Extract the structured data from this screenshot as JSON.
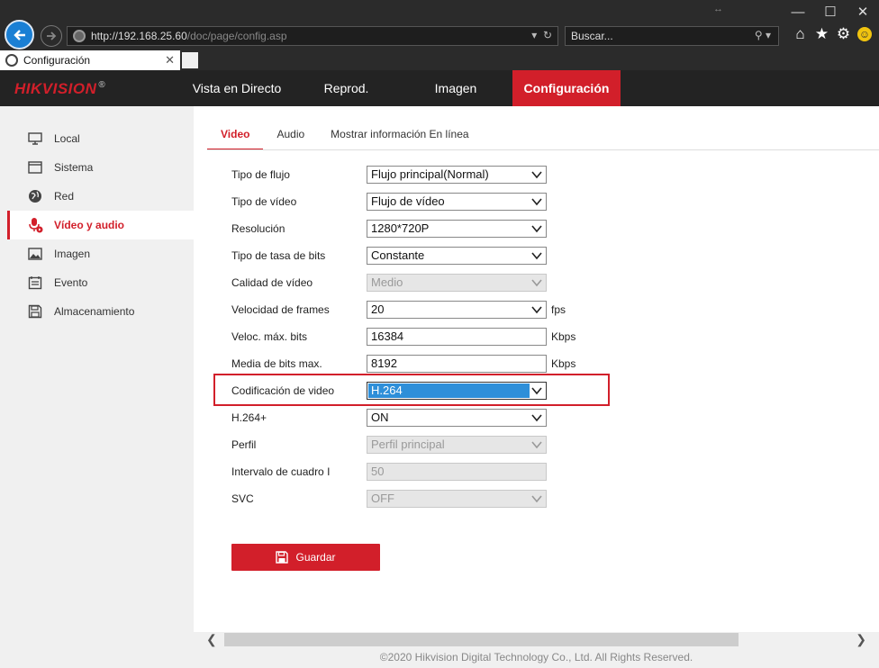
{
  "browser": {
    "url_host": "http://192.168.25.60",
    "url_path": "/doc/page/config.asp",
    "search_placeholder": "Buscar...",
    "tab_title": "Configuración"
  },
  "header": {
    "logo": "HIKVISION",
    "logo_mark": "®",
    "nav": [
      "Vista en Directo",
      "Reprod.",
      "Imagen",
      "Configuración"
    ],
    "active_nav": "Configuración"
  },
  "sidebar": {
    "items": [
      {
        "label": "Local",
        "icon": "monitor-icon"
      },
      {
        "label": "Sistema",
        "icon": "window-icon"
      },
      {
        "label": "Red",
        "icon": "globe-icon"
      },
      {
        "label": "Vídeo y audio",
        "icon": "mic-icon"
      },
      {
        "label": "Imagen",
        "icon": "image-icon"
      },
      {
        "label": "Evento",
        "icon": "calendar-icon"
      },
      {
        "label": "Almacenamiento",
        "icon": "disk-icon"
      }
    ],
    "active": "Vídeo y audio"
  },
  "content": {
    "tabs": [
      "Video",
      "Audio",
      "Mostrar información En línea"
    ],
    "active_tab": "Video",
    "fields": [
      {
        "label": "Tipo de flujo",
        "value": "Flujo principal(Normal)",
        "kind": "select"
      },
      {
        "label": "Tipo de vídeo",
        "value": "Flujo de vídeo",
        "kind": "select"
      },
      {
        "label": "Resolución",
        "value": "1280*720P",
        "kind": "select"
      },
      {
        "label": "Tipo de tasa de bits",
        "value": "Constante",
        "kind": "select"
      },
      {
        "label": "Calidad de vídeo",
        "value": "Medio",
        "kind": "select-disabled"
      },
      {
        "label": "Velocidad de frames",
        "value": "20",
        "kind": "select",
        "unit": "fps"
      },
      {
        "label": "Veloc. máx. bits",
        "value": "16384",
        "kind": "input",
        "unit": "Kbps"
      },
      {
        "label": "Media de bits max.",
        "value": "8192",
        "kind": "input",
        "unit": "Kbps"
      },
      {
        "label": "Codificación de video",
        "value": "H.264",
        "kind": "select-highlight"
      },
      {
        "label": "H.264+",
        "value": "ON",
        "kind": "select"
      },
      {
        "label": "Perfil",
        "value": "Perfil principal",
        "kind": "select-disabled"
      },
      {
        "label": "Intervalo de cuadro I",
        "value": "50",
        "kind": "input-disabled"
      },
      {
        "label": "SVC",
        "value": "OFF",
        "kind": "select-disabled"
      }
    ],
    "save_label": "Guardar"
  },
  "footer": {
    "copyright": "©2020 Hikvision Digital Technology Co., Ltd. All Rights Reserved."
  },
  "colors": {
    "brand_red": "#d21f2a",
    "highlight_blue": "#2e8fd9",
    "header_bg": "#232323"
  }
}
